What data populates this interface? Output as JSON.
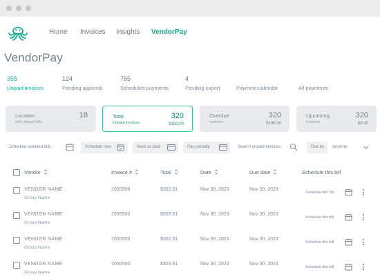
{
  "nav": {
    "items": [
      {
        "label": "Home",
        "active": false
      },
      {
        "label": "Invoices",
        "active": false
      },
      {
        "label": "Insights",
        "active": false
      },
      {
        "label": "VendorPay",
        "active": true
      }
    ]
  },
  "page": {
    "title": "VendorPay"
  },
  "tabs": [
    {
      "count": "355",
      "label": "Unpaid invoices",
      "active": true
    },
    {
      "count": "124",
      "label": "Pending approval",
      "active": false
    },
    {
      "count": "755",
      "label": "Scheduled payments",
      "active": false
    },
    {
      "count": "4",
      "label": "Pending export",
      "active": false
    },
    {
      "count": "",
      "label": "Payment calendar",
      "active": false
    },
    {
      "count": "",
      "label": "All payments",
      "active": false
    }
  ],
  "cards": [
    {
      "title": "Location",
      "sub": "with unpaid bills",
      "amount": "18",
      "value": "",
      "active": false
    },
    {
      "title": "Total",
      "sub": "Unpaid invoices",
      "amount": "320",
      "value": "$100.00",
      "active": true
    },
    {
      "title": "Overdue",
      "sub": "Invoices",
      "amount": "320",
      "value": "$100.00",
      "active": false
    },
    {
      "title": "Upcoming",
      "sub": "Invoices",
      "amount": "320",
      "value": "$0.00",
      "active": false
    }
  ],
  "toolbar": {
    "schedule_selected": "Schedule selected bills",
    "schedule_now": "Schedule now",
    "mark_as_paid": "Mark as paid",
    "pay_partially": "Pay partially",
    "search_placeholder": "Search unpaid invoices",
    "due_by_label": "Due by",
    "due_by_value": "Anytime"
  },
  "table": {
    "headers": {
      "vendor": "Vendor",
      "invoice": "Invoice #",
      "total": "Total",
      "date": "Date",
      "due_date": "Due date",
      "schedule": "Schedule this bill"
    },
    "rows": [
      {
        "vendor": "VENDOR NAME",
        "group": "Group Name",
        "invoice": "1050500",
        "total": "$302.51",
        "date": "Nov 30, 2023",
        "due_date": "Nov 30, 2023",
        "schedule": "Schedule this bill"
      },
      {
        "vendor": "VENDOR NAME",
        "group": "Group Name",
        "invoice": "1050500",
        "total": "$302.51",
        "date": "Nov 30, 2023",
        "due_date": "Nov 30, 2023",
        "schedule": "Schedule this bill"
      },
      {
        "vendor": "VENDOR NAME",
        "group": "Group Name",
        "invoice": "1050500",
        "total": "$302.51",
        "date": "Nov 30, 2023",
        "due_date": "Nov 30, 2023",
        "schedule": "Schedule this bill"
      },
      {
        "vendor": "VENDOR NAME",
        "group": "Group Name",
        "invoice": "1050500",
        "total": "$302.51",
        "date": "Nov 30, 2023",
        "due_date": "Nov 30, 2023",
        "schedule": "Schedule this bill"
      }
    ]
  },
  "colors": {
    "accent": "#1aa98f",
    "card_border": "#35c4a8",
    "card_bg": "#e8ebee",
    "chrome": "#ececef"
  }
}
